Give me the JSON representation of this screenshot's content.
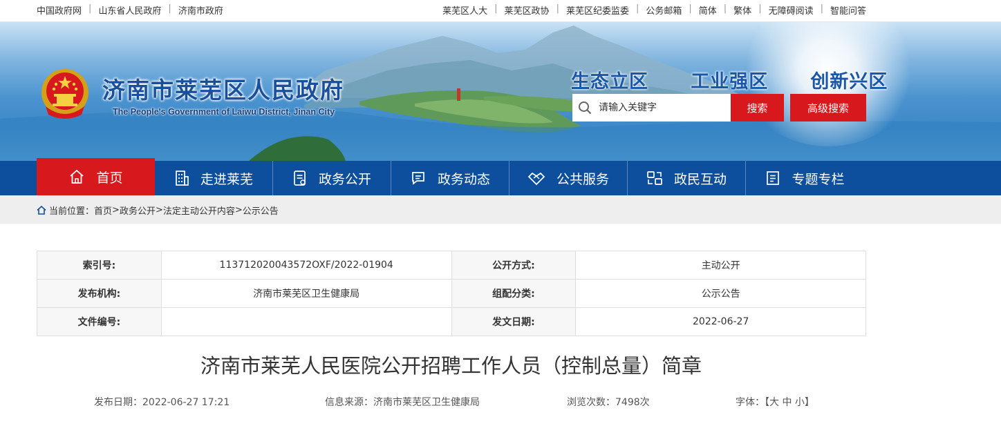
{
  "topbar": {
    "left": [
      "中国政府网",
      "山东省人民政府",
      "济南市政府"
    ],
    "right": [
      "莱芜区人大",
      "莱芜区政协",
      "莱芜区纪委监委",
      "公务邮箱",
      "简体",
      "繁体",
      "无障碍阅读",
      "智能问答"
    ]
  },
  "header": {
    "title_cn": "济南市莱芜区人民政府",
    "title_en": "The People's Government of Laiwu District, Jinan City",
    "slogan": "生态立区   工业强区   创新兴区",
    "search_placeholder": "请输入关键字",
    "search_label": "搜索",
    "advanced_search_label": "高级搜索"
  },
  "nav": [
    {
      "label": "首页",
      "icon": "home-icon"
    },
    {
      "label": "走进莱芜",
      "icon": "building-icon"
    },
    {
      "label": "政务公开",
      "icon": "document-icon"
    },
    {
      "label": "政务动态",
      "icon": "chat-icon"
    },
    {
      "label": "公共服务",
      "icon": "handshake-icon"
    },
    {
      "label": "政民互动",
      "icon": "interaction-icon"
    },
    {
      "label": "专题专栏",
      "icon": "column-icon"
    }
  ],
  "breadcrumb": {
    "prefix": "当前位置：",
    "items": [
      "首页",
      "政务公开",
      "法定主动公开内容",
      "公示公告"
    ]
  },
  "info": {
    "index_label": "索引号:",
    "index_value": "113712020043572OXF/2022-01904",
    "method_label": "公开方式:",
    "method_value": "主动公开",
    "publisher_label": "发布机构:",
    "publisher_value": "济南市莱芜区卫生健康局",
    "category_label": "组配分类:",
    "category_value": "公示公告",
    "docno_label": "文件编号:",
    "docno_value": "",
    "date_label": "发文日期:",
    "date_value": "2022-06-27"
  },
  "article": {
    "title": "济南市莱芜人民医院公开招聘工作人员（控制总量）简章",
    "publish_date": "发布日期：2022-06-27 17:21",
    "source": "信息来源：济南市莱芜区卫生健康局",
    "views": "浏览次数：7498次",
    "font_size": "字体：【大 中 小】"
  }
}
